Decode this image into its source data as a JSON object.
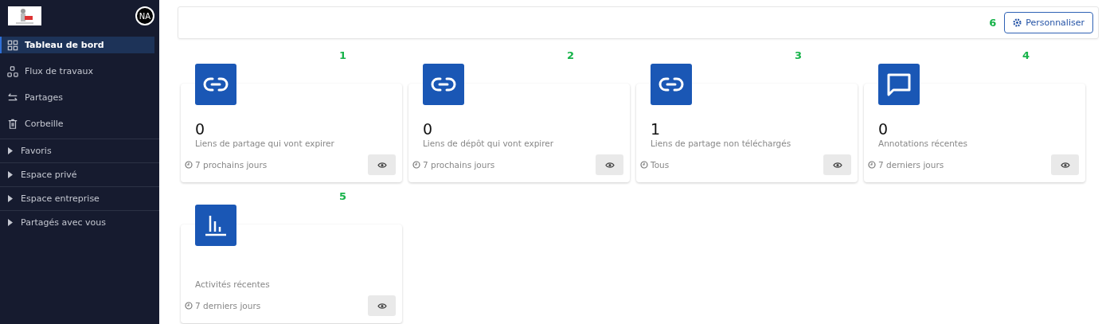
{
  "sidebar": {
    "avatar": "NA",
    "nav_items": [
      {
        "label": "Tableau de bord",
        "selected": true
      },
      {
        "label": "Flux de travaux",
        "selected": false
      },
      {
        "label": "Partages",
        "selected": false
      },
      {
        "label": "Corbeille",
        "selected": false
      }
    ],
    "sections": [
      {
        "label": "Favoris",
        "expanded": false
      },
      {
        "label": "Espace privé",
        "expanded": false
      },
      {
        "label": "Espace entreprise",
        "expanded": false
      },
      {
        "label": "Partagés avec vous",
        "expanded": false
      }
    ]
  },
  "header": {
    "marker": "6",
    "button": "Personnaliser"
  },
  "cards": [
    {
      "marker": "1",
      "kind": "link",
      "count": "0",
      "label": "Liens de partage qui vont expirer",
      "period": "7 prochains jours"
    },
    {
      "marker": "2",
      "kind": "link",
      "count": "0",
      "label": "Liens de dépôt qui vont expirer",
      "period": "7 prochains jours"
    },
    {
      "marker": "3",
      "kind": "link",
      "count": "1",
      "label": "Liens de partage non téléchargés",
      "period": "Tous"
    },
    {
      "marker": "4",
      "kind": "comment",
      "count": "0",
      "label": "Annotations récentes",
      "period": "7 derniers jours"
    },
    {
      "marker": "5",
      "kind": "chart",
      "label": "Activités récentes",
      "period": "7 derniers jours"
    }
  ]
}
